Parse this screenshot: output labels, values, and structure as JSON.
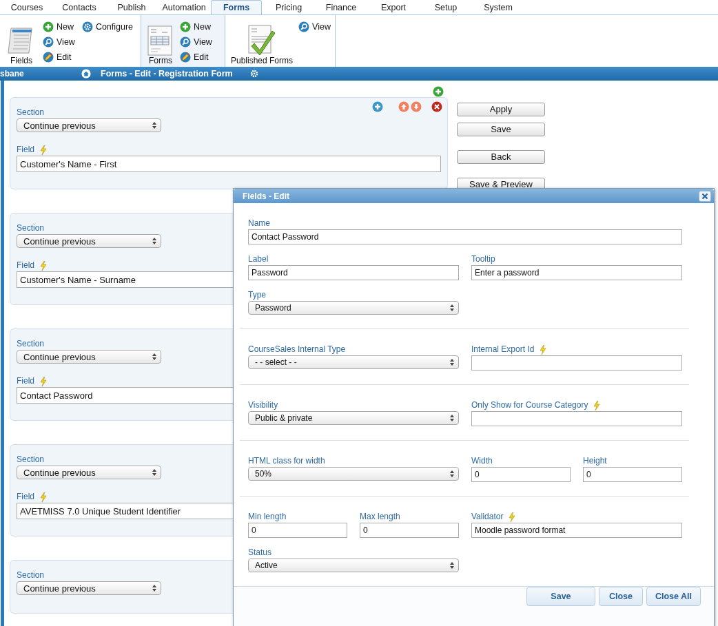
{
  "tabs": [
    {
      "label": "Courses",
      "selected": false
    },
    {
      "label": "Contacts",
      "selected": false
    },
    {
      "label": "Publish",
      "selected": false
    },
    {
      "label": "Automation",
      "selected": false
    },
    {
      "label": "Forms",
      "selected": true
    },
    {
      "label": "Pricing",
      "selected": false
    },
    {
      "label": "Finance",
      "selected": false
    },
    {
      "label": "Export",
      "selected": false
    },
    {
      "label": "Setup",
      "selected": false
    },
    {
      "label": "System",
      "selected": false
    }
  ],
  "ribbon": [
    {
      "label": "Fields",
      "kind": "stack",
      "selected": false,
      "actions": [
        {
          "label": "New",
          "kind": "new"
        },
        {
          "label": "View",
          "kind": "view"
        },
        {
          "label": "Edit",
          "kind": "edit"
        },
        {
          "label": "Configure",
          "kind": "configure"
        }
      ]
    },
    {
      "label": "Forms",
      "kind": "form",
      "selected": true,
      "actions": [
        {
          "label": "New",
          "kind": "new"
        },
        {
          "label": "View",
          "kind": "view"
        },
        {
          "label": "Edit",
          "kind": "edit"
        }
      ]
    },
    {
      "label": "Published Forms",
      "kind": "published",
      "selected": false,
      "actions": [
        {
          "label": "View",
          "kind": "view"
        }
      ]
    }
  ],
  "title_bar": {
    "location": "sbane",
    "title": "Forms - Edit - Registration Form"
  },
  "form_rows": [
    {
      "show_actions": true,
      "section_label": "Section",
      "section": "Continue previous",
      "field_label": "Field",
      "field": "Customer's Name - First"
    },
    {
      "show_actions": false,
      "section_label": "Section",
      "section": "Continue previous",
      "field_label": "Field",
      "field": "Customer's Name - Surname"
    },
    {
      "show_actions": false,
      "section_label": "Section",
      "section": "Continue previous",
      "field_label": "Field",
      "field": "Contact Password"
    },
    {
      "show_actions": false,
      "section_label": "Section",
      "section": "Continue previous",
      "field_label": "Field",
      "field": "AVETMISS 7.0 Unique Student Identifier"
    },
    {
      "show_actions": false,
      "section_label": "Section",
      "section": "Continue previous"
    }
  ],
  "side_buttons": [
    "Apply",
    "Save",
    "Back",
    "Save & Preview"
  ],
  "dialog": {
    "title": "Fields - Edit",
    "sections": [
      [
        {
          "fields": [
            {
              "kind": "text",
              "label": "Name",
              "value": "Contact Password",
              "hint_icon": false
            }
          ]
        },
        {
          "fields": [
            {
              "kind": "text",
              "label": "Label",
              "value": "Password",
              "hint_icon": false
            },
            {
              "kind": "text",
              "label": "Tooltip",
              "value": "Enter a password",
              "hint_icon": false
            }
          ]
        },
        {
          "fields": [
            {
              "kind": "select",
              "label": "Type",
              "value": "Password",
              "hint_icon": false
            }
          ]
        }
      ],
      [
        {
          "fields": [
            {
              "kind": "select",
              "label": "CourseSales Internal Type",
              "value": "- - select - -",
              "hint_icon": false
            },
            {
              "kind": "text",
              "label": "Internal Export Id",
              "hint_icon": true
            }
          ]
        }
      ],
      [
        {
          "fields": [
            {
              "kind": "select",
              "label": "Visibility",
              "value": "Public & private",
              "hint_icon": false
            },
            {
              "kind": "text",
              "label": "Only Show for Course Category",
              "hint_icon": true
            }
          ]
        }
      ],
      [
        {
          "fields": [
            {
              "kind": "select",
              "label": "HTML class for width",
              "value": "50%",
              "hint_icon": false
            },
            {
              "kind": "text",
              "label": "Width",
              "value": "0",
              "hint_icon": false
            },
            {
              "kind": "text",
              "label": "Height",
              "value": "0",
              "hint_icon": false
            }
          ]
        }
      ],
      [
        {
          "fields": [
            {
              "kind": "text",
              "label": "Min length",
              "value": "0",
              "hint_icon": false
            },
            {
              "kind": "text",
              "label": "Max length",
              "value": "0",
              "hint_icon": false
            },
            {
              "kind": "text",
              "label": "Validator",
              "value": "Moodle password format",
              "hint_icon": true
            }
          ]
        },
        {
          "fields": [
            {
              "kind": "select",
              "label": "Status",
              "value": "Active",
              "hint_icon": false
            }
          ]
        }
      ]
    ],
    "buttons": [
      "Save",
      "Close",
      "Close All"
    ]
  }
}
